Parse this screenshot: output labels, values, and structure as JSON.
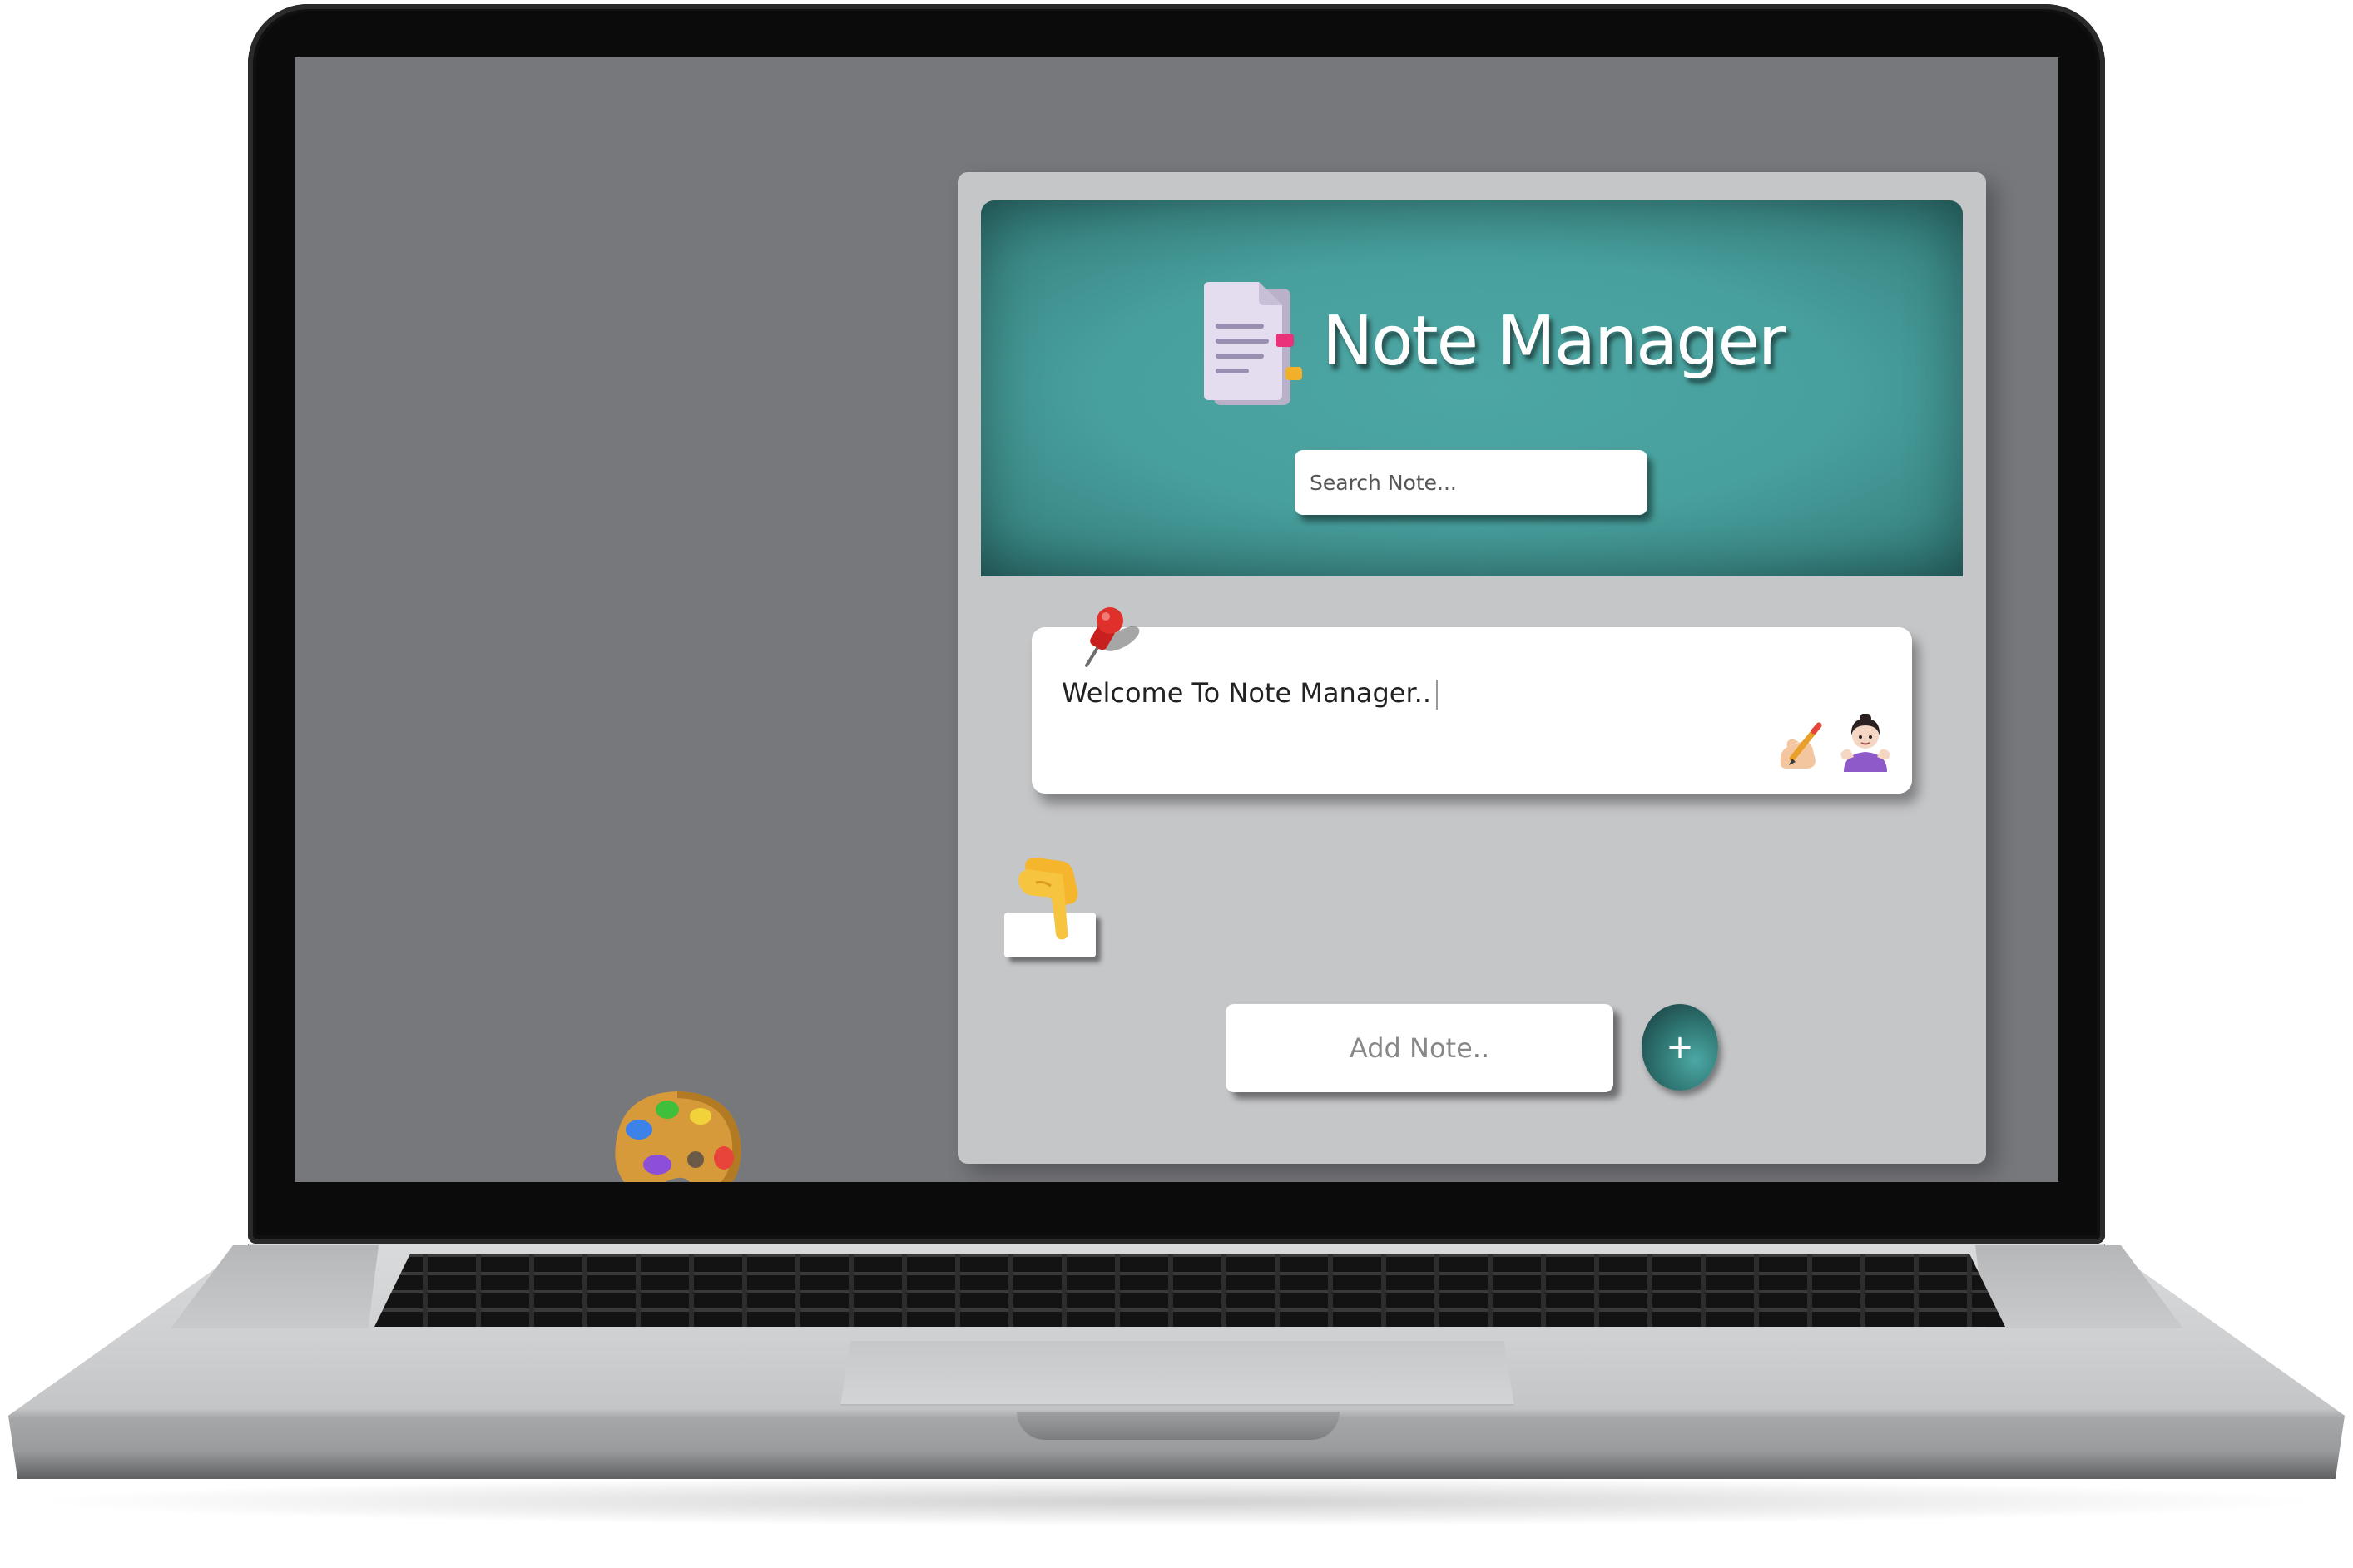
{
  "app": {
    "title": "Note Manager",
    "search": {
      "placeholder": "Search Note..."
    },
    "notes": [
      {
        "text": "Welcome To Note Manager.."
      }
    ],
    "add_note": {
      "placeholder": "Add Note..",
      "button_label": "+"
    }
  },
  "icons": {
    "header": "notepad-document-icon",
    "note_pin": "pushpin-icon",
    "note_edit": "hand-writing-pencil-icon",
    "note_delete": "person-shrugging-icon",
    "hint": "pointing-hand-icon",
    "theme": "artist-palette-icon"
  },
  "colors": {
    "header_teal": "#48a09d",
    "app_panel": "#c5c6c8",
    "screen_bg": "#77787c",
    "add_button": "#2f7774"
  }
}
